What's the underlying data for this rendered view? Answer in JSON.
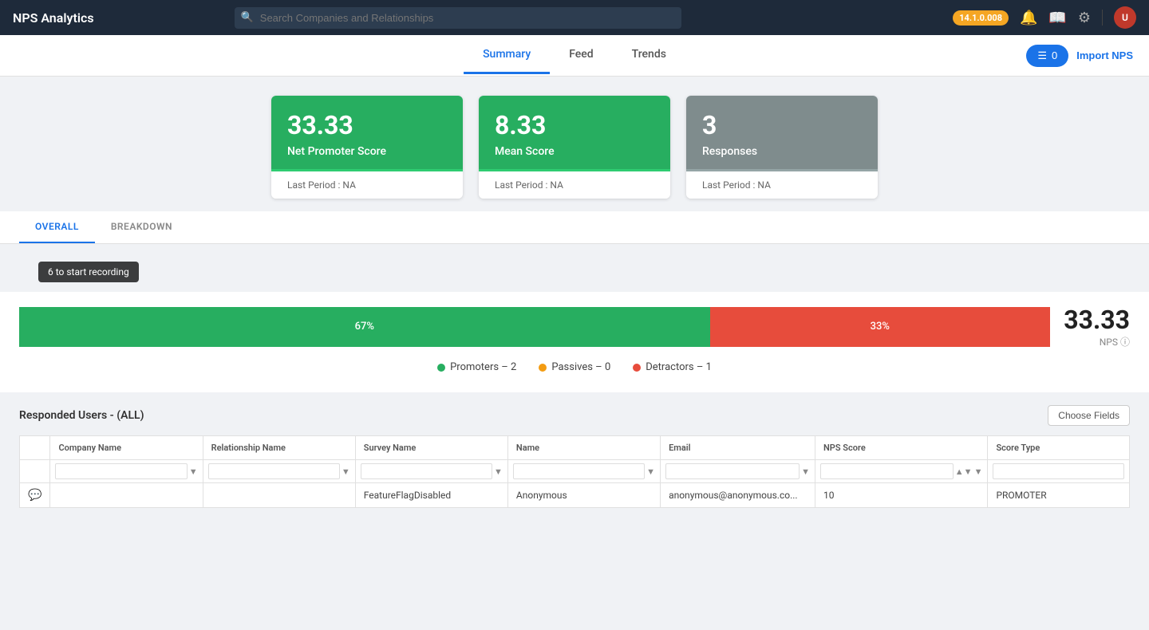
{
  "app": {
    "title": "NPS Analytics",
    "version": "14.1.0.008"
  },
  "search": {
    "placeholder": "Search Companies and Relationships"
  },
  "tabs": {
    "items": [
      {
        "id": "summary",
        "label": "Summary",
        "active": true
      },
      {
        "id": "feed",
        "label": "Feed",
        "active": false
      },
      {
        "id": "trends",
        "label": "Trends",
        "active": false
      }
    ],
    "count_button": "0",
    "import_button": "Import NPS"
  },
  "metrics": [
    {
      "id": "nps",
      "value": "33.33",
      "label": "Net Promoter Score",
      "last_period": "Last Period : NA",
      "color": "green"
    },
    {
      "id": "mean",
      "value": "8.33",
      "label": "Mean Score",
      "last_period": "Last Period : NA",
      "color": "green"
    },
    {
      "id": "responses",
      "value": "3",
      "label": "Responses",
      "last_period": "Last Period : NA",
      "color": "gray"
    }
  ],
  "segment_tabs": [
    {
      "id": "overall",
      "label": "OVERALL",
      "active": true
    },
    {
      "id": "breakdown",
      "label": "BREAKDOWN",
      "active": false
    }
  ],
  "recording_hint": "6 to start recording",
  "chart": {
    "green_pct": "67%",
    "red_pct": "33%",
    "green_width": 67,
    "red_width": 33,
    "nps_score": "33.33",
    "nps_label": "NPS"
  },
  "legend": [
    {
      "id": "promoters",
      "label": "Promoters – 2",
      "color": "#27ae60"
    },
    {
      "id": "passives",
      "label": "Passives – 0",
      "color": "#f39c12"
    },
    {
      "id": "detractors",
      "label": "Detractors – 1",
      "color": "#e74c3c"
    }
  ],
  "table": {
    "title": "Responded Users - (ALL)",
    "choose_fields": "Choose Fields",
    "columns": [
      "Company Name",
      "Relationship Name",
      "Survey Name",
      "Name",
      "Email",
      "NPS Score",
      "Score Type"
    ],
    "rows": [
      {
        "company_name": "",
        "relationship_name": "",
        "survey_name": "FeatureFlagDisabled",
        "name": "Anonymous",
        "email": "anonymous@anonymous.co...",
        "nps_score": "10",
        "score_type": "PROMOTER",
        "has_chat": true
      }
    ]
  }
}
